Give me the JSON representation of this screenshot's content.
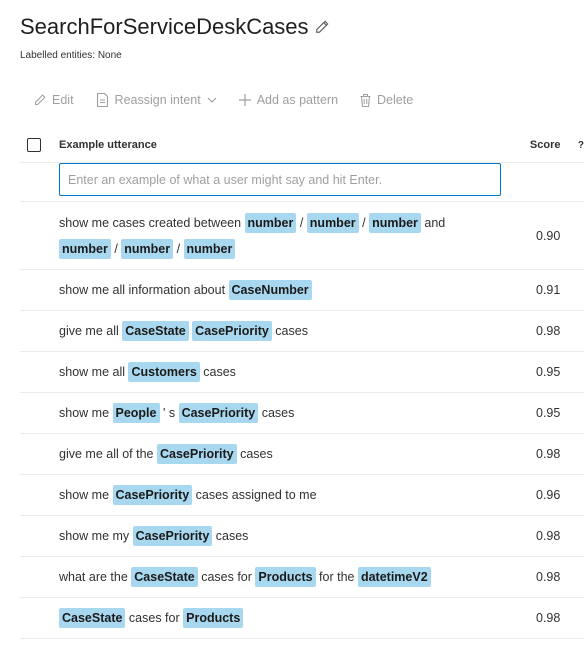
{
  "header": {
    "title": "SearchForServiceDeskCases",
    "subtitle": "Labelled entities: None"
  },
  "toolbar": {
    "edit": "Edit",
    "reassign": "Reassign intent",
    "add_pattern": "Add as pattern",
    "delete": "Delete"
  },
  "table": {
    "col_utterance": "Example utterance",
    "col_score": "Score",
    "col_help": "?",
    "input_placeholder": "Enter an example of what a user might say and hit Enter.",
    "rows": [
      {
        "score": "0.90",
        "segments": [
          {
            "t": "show me cases created between "
          },
          {
            "e": "number"
          },
          {
            "t": " / "
          },
          {
            "e": "number"
          },
          {
            "t": " / "
          },
          {
            "e": "number"
          },
          {
            "t": " and "
          },
          {
            "e": "number"
          },
          {
            "t": " / "
          },
          {
            "e": "number"
          },
          {
            "t": " / "
          },
          {
            "e": "number"
          }
        ]
      },
      {
        "score": "0.91",
        "segments": [
          {
            "t": "show me all information about "
          },
          {
            "e": "CaseNumber"
          }
        ]
      },
      {
        "score": "0.98",
        "segments": [
          {
            "t": "give me all "
          },
          {
            "e": "CaseState"
          },
          {
            "t": " "
          },
          {
            "e": "CasePriority"
          },
          {
            "t": " cases"
          }
        ]
      },
      {
        "score": "0.95",
        "segments": [
          {
            "t": "show me all "
          },
          {
            "e": "Customers"
          },
          {
            "t": " cases"
          }
        ]
      },
      {
        "score": "0.95",
        "segments": [
          {
            "t": "show me "
          },
          {
            "e": "People"
          },
          {
            "t": " ' s "
          },
          {
            "e": "CasePriority"
          },
          {
            "t": " cases"
          }
        ]
      },
      {
        "score": "0.98",
        "segments": [
          {
            "t": "give me all of the "
          },
          {
            "e": "CasePriority"
          },
          {
            "t": " cases"
          }
        ]
      },
      {
        "score": "0.96",
        "segments": [
          {
            "t": "show me "
          },
          {
            "e": "CasePriority"
          },
          {
            "t": " cases assigned to me"
          }
        ]
      },
      {
        "score": "0.98",
        "segments": [
          {
            "t": "show me my "
          },
          {
            "e": "CasePriority"
          },
          {
            "t": " cases"
          }
        ]
      },
      {
        "score": "0.98",
        "segments": [
          {
            "t": "what are the "
          },
          {
            "e": "CaseState"
          },
          {
            "t": " cases for "
          },
          {
            "e": "Products"
          },
          {
            "t": " for the "
          },
          {
            "e": "datetimeV2"
          }
        ]
      },
      {
        "score": "0.98",
        "segments": [
          {
            "e": "CaseState"
          },
          {
            "t": " cases for "
          },
          {
            "e": "Products"
          }
        ]
      }
    ]
  }
}
